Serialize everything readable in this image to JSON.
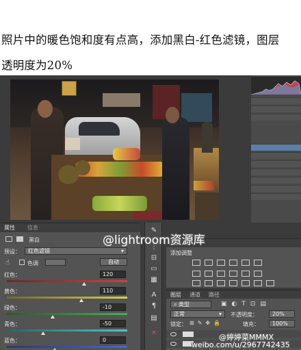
{
  "caption": {
    "line1": "照片中的暖色饱和度有点高，添加黑白-红色滤镜，图层",
    "line2": "透明度为20%"
  },
  "properties_panel": {
    "tabs": [
      "属性",
      "信息"
    ],
    "preset_label": "黑白",
    "preset_row_label": "预设：",
    "preset_value": "红色滤镜",
    "tint_label": "色调",
    "auto_button": "自动",
    "sliders": [
      {
        "label": "红色：",
        "value": "120",
        "level": 120,
        "min": -200,
        "max": 300,
        "gradient": [
          "#6b2a2a",
          "#d04040"
        ]
      },
      {
        "label": "黄色：",
        "value": "110",
        "level": 110,
        "min": -200,
        "max": 300,
        "gradient": [
          "#6f6a2a",
          "#d8d24a"
        ]
      },
      {
        "label": "绿色：",
        "value": "-10",
        "level": -10,
        "min": -200,
        "max": 300,
        "gradient": [
          "#2d5a2d",
          "#46b04a"
        ]
      },
      {
        "label": "青色：",
        "value": "-50",
        "level": -50,
        "min": -200,
        "max": 300,
        "gradient": [
          "#2a6464",
          "#48c8c8"
        ]
      },
      {
        "label": "蓝色：",
        "value": "0",
        "level": 0,
        "min": -200,
        "max": 300,
        "gradient": [
          "#2a3a6a",
          "#4a64d8"
        ]
      }
    ]
  },
  "adjustments_panel": {
    "tab": "调整",
    "title": "添加调整"
  },
  "layers_panel": {
    "tabs": [
      "图层",
      "通道",
      "路径"
    ],
    "filter_label": "类型",
    "blend_mode": "正常",
    "opacity_label": "不透明度：",
    "opacity_value": "20%",
    "lock_label": "锁定：",
    "fill_label": "填充：",
    "fill_value": "100%"
  },
  "watermarks": {
    "center": "@lightroom资源库",
    "bottom_line1": "@婷婷菜MMMX",
    "bottom_line2": "weibo.com/u/2967742435"
  },
  "colors": {
    "panel_bg": "#535353",
    "dark_bg": "#3b3b3b",
    "selected_layer": "#5d7ea8"
  }
}
